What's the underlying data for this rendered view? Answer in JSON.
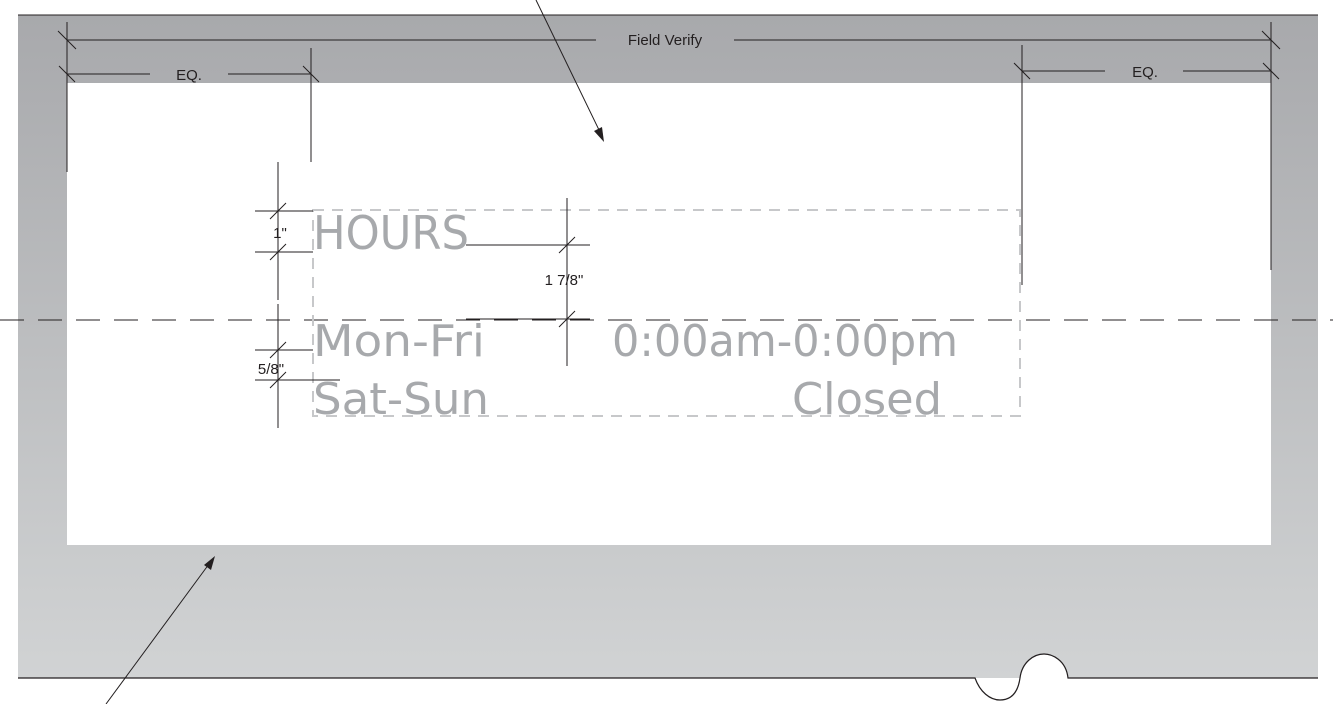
{
  "dimensions": {
    "overall_width": "Field Verify",
    "left_margin": "EQ.",
    "right_margin": "EQ.",
    "cap_height": "1\"",
    "title_to_body": "1 7/8\"",
    "body_cap_height": "5/8\""
  },
  "sign": {
    "title": "HOURS",
    "rows": [
      {
        "days": "Mon-Fri",
        "hours": "0:00am-0:00pm"
      },
      {
        "days": "Sat-Sun",
        "hours": "Closed"
      }
    ]
  },
  "colors": {
    "linework": "#231f20",
    "sign_text": "#a7a9ac",
    "wall_panel": "#a8a9ac",
    "panel_light": "#d1d3d4",
    "dashed_box": "#c7c8ca"
  }
}
